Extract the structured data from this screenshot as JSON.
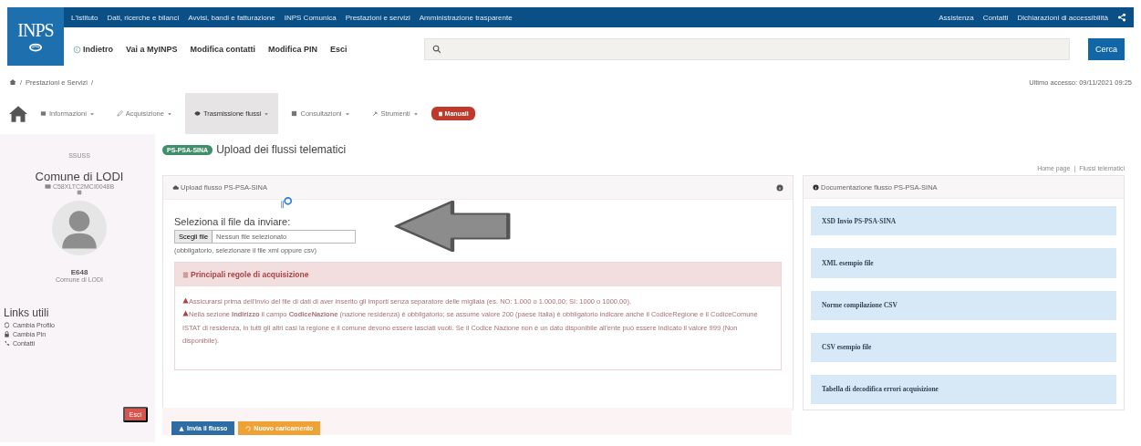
{
  "header": {
    "logo": "INPS",
    "top_links": [
      "L'Istituto",
      "Dati, ricerche e bilanci",
      "Avvisi, bandi e fatturazione",
      "INPS Comunica",
      "Prestazioni e servizi",
      "Amministrazione trasparente"
    ],
    "right_links": [
      "Assistenza",
      "Contatti",
      "Dichiarazioni di accessibilità"
    ],
    "nav_links": [
      "Indietro",
      "Vai a MyINPS",
      "Modifica contatti",
      "Modifica PIN",
      "Esci"
    ],
    "search": {
      "button": "Cerca"
    }
  },
  "breadcrumb": {
    "items": [
      "Prestazioni e Servizi"
    ],
    "separator": "/"
  },
  "last_access": "Ultimo accesso: 09/11/2021 09:25",
  "menu": {
    "items": [
      {
        "label": "Informazioni",
        "selected": false
      },
      {
        "label": "Acquisizione",
        "selected": false
      },
      {
        "label": "Trasmissione flussi",
        "selected": true
      },
      {
        "label": "Consultazioni",
        "selected": false
      },
      {
        "label": "Strumenti",
        "selected": false
      }
    ],
    "badge": "Manuali"
  },
  "sidebar": {
    "code": "SSUSS",
    "entity": "Comune di LODI",
    "fiscal_code": "C58XLTC2MCI0048B",
    "id": "E648",
    "id_caption": "Comune di LODI",
    "links_title": "Links utili",
    "links": [
      "Cambia Profilo",
      "Cambia Pin",
      "Contatti"
    ],
    "logout": "Esci"
  },
  "page": {
    "badge": "PS-PSA-SINA",
    "title": "Upload dei flussi telematici",
    "breadcrumb": {
      "items": [
        "Home page",
        "Flussi telematici"
      ],
      "separator": "|"
    }
  },
  "upload": {
    "header": "Upload flusso PS-PSA-SINA",
    "label": "Seleziona il file da inviare:",
    "file_button": "Scegli file",
    "file_value": "Nessun file selezionato",
    "hint": "(obbligatorio, selezionare il file xml oppure csv)",
    "rules_title": "Principali regole di acquisizione",
    "rules": [
      "Assicurarsi prima dell'invio del file di dati di aver inserito gli importi senza separatore delle migliaia (es. NO: 1.000 o 1.000,00; SI: 1000 o 1000,00).",
      "Nella sezione **Indirizzo** il campo **CodiceNazione** (nazione residenza) è obbligatorio; se assume valore 200 (paese Italia) è obbligatorio indicare anche il CodiceRegione e il CodiceComune ISTAT di residenza, in tutti gli altri casi la regione e il comune devono essere lasciati vuoti. Se il Codice Nazione non è un dato disponibile all'ente può essere indicato il valore 999 (Non disponibile)."
    ],
    "buttons": [
      {
        "label": "Invia il flusso",
        "kind": "primary"
      },
      {
        "label": "Nuovo caricamento",
        "kind": "warning"
      }
    ]
  },
  "docs": {
    "header": "Documentazione flusso PS-PSA-SINA",
    "items": [
      "XSD Invio PS-PSA-SINA",
      "XML esempio file",
      "Norme compilazione CSV",
      "CSV esempio file",
      "Tabella di decodifica errori acquisizione"
    ]
  }
}
